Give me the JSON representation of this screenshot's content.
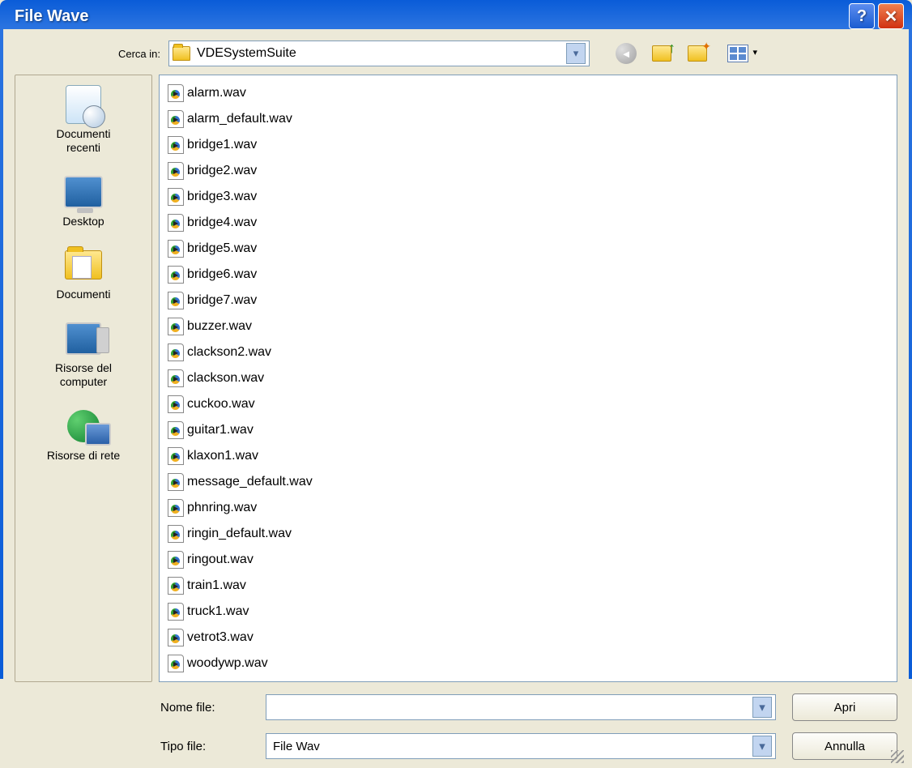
{
  "title": "File Wave",
  "lookin": {
    "label": "Cerca in:",
    "value": "VDESystemSuite"
  },
  "places": [
    {
      "label": "Documenti\nrecenti",
      "key": "recent"
    },
    {
      "label": "Desktop",
      "key": "desktop"
    },
    {
      "label": "Documenti",
      "key": "documents"
    },
    {
      "label": "Risorse del\ncomputer",
      "key": "computer"
    },
    {
      "label": "Risorse di rete",
      "key": "network"
    }
  ],
  "files": [
    "alarm.wav",
    "alarm_default.wav",
    "bridge1.wav",
    "bridge2.wav",
    "bridge3.wav",
    "bridge4.wav",
    "bridge5.wav",
    "bridge6.wav",
    "bridge7.wav",
    "buzzer.wav",
    "clackson2.wav",
    "clackson.wav",
    "cuckoo.wav",
    "guitar1.wav",
    "klaxon1.wav",
    "message_default.wav",
    "phnring.wav",
    "ringin_default.wav",
    "ringout.wav",
    "train1.wav",
    "truck1.wav",
    "vetrot3.wav",
    "woodywp.wav"
  ],
  "filename": {
    "label": "Nome file:",
    "value": ""
  },
  "filetype": {
    "label": "Tipo file:",
    "value": "File Wav"
  },
  "buttons": {
    "open": "Apri",
    "cancel": "Annulla"
  }
}
